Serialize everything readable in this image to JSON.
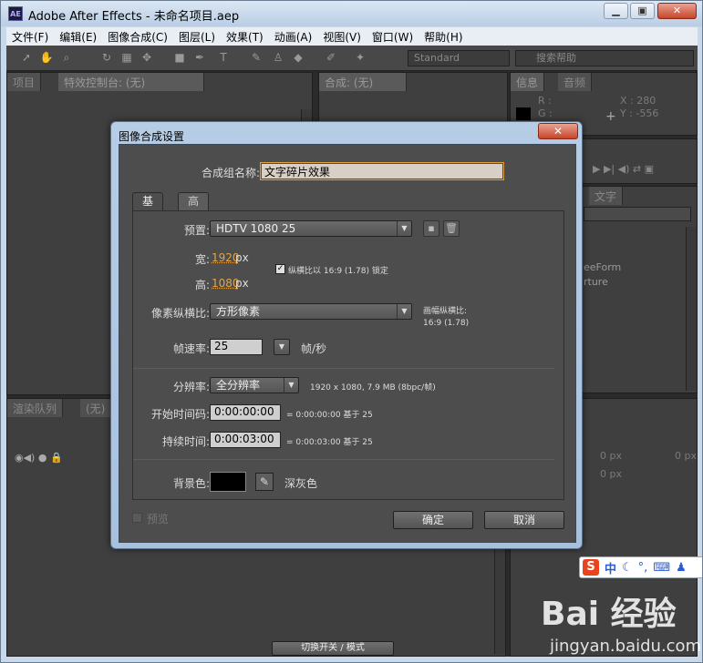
{
  "window": {
    "title": "Adobe After Effects - 未命名项目.aep",
    "app_icon": "AE"
  },
  "menu": [
    "文件(F)",
    "编辑(E)",
    "图像合成(C)",
    "图层(L)",
    "效果(T)",
    "动画(A)",
    "视图(V)",
    "窗口(W)",
    "帮助(H)"
  ],
  "toolbar": {
    "workspace": "Standard",
    "search_placeholder": "搜索帮助"
  },
  "panels": {
    "project_tab": "项目",
    "effects_tab": "特效控制台: (无)",
    "comp_tab": "合成: (无)",
    "info_tab": "信息",
    "audio_tab": "音频",
    "info_r": "R :",
    "info_g": "G :",
    "info_x": "X : 280",
    "info_y": "Y : -556",
    "char_tab": "文字",
    "effect_item1": "eeForm",
    "effect_item2": "rture",
    "render_tab": "渲染队列",
    "none_tab": "(无)",
    "para1": "0 px",
    "para2": "0 px",
    "para3": "0 px",
    "toggle_switch": "切换开关 / 模式"
  },
  "dialog": {
    "title": "图像合成设置",
    "close": "✕",
    "name_label": "合成组名称:",
    "name_value": "文字碎片效果",
    "tabs": [
      "基本",
      "高级"
    ],
    "preset_label": "预置:",
    "preset_value": "HDTV 1080 25",
    "width_label": "宽:",
    "width_value": "1920",
    "height_label": "高:",
    "height_value": "1080",
    "unit": "px",
    "lock_label": "纵横比以 16:9 (1.78) 锁定",
    "pixel_label": "像素纵横比:",
    "pixel_value": "方形像素",
    "frame_aspect_label": "画幅纵横比:",
    "frame_aspect_value": "16:9 (1.78)",
    "fps_label": "帧速率:",
    "fps_value": "25",
    "fps_unit": "帧/秒",
    "res_label": "分辨率:",
    "res_value": "全分辨率",
    "res_info": "1920 x 1080, 7.9 MB (8bpc/帧)",
    "start_label": "开始时间码:",
    "start_value": "0:00:00:00",
    "start_info": "= 0:00:00:00  基于 25",
    "dur_label": "持续时间:",
    "dur_value": "0:00:03:00",
    "dur_info": "= 0:00:03:00  基于 25",
    "bg_label": "背景色:",
    "bg_name": "深灰色",
    "bg_color": "#000000",
    "preview": "预览",
    "ok": "确定",
    "cancel": "取消"
  },
  "ime": {
    "logo": "S",
    "mode": "中"
  },
  "watermark": {
    "main": "Bai 经验",
    "sub": "jingyan.baidu.com"
  }
}
